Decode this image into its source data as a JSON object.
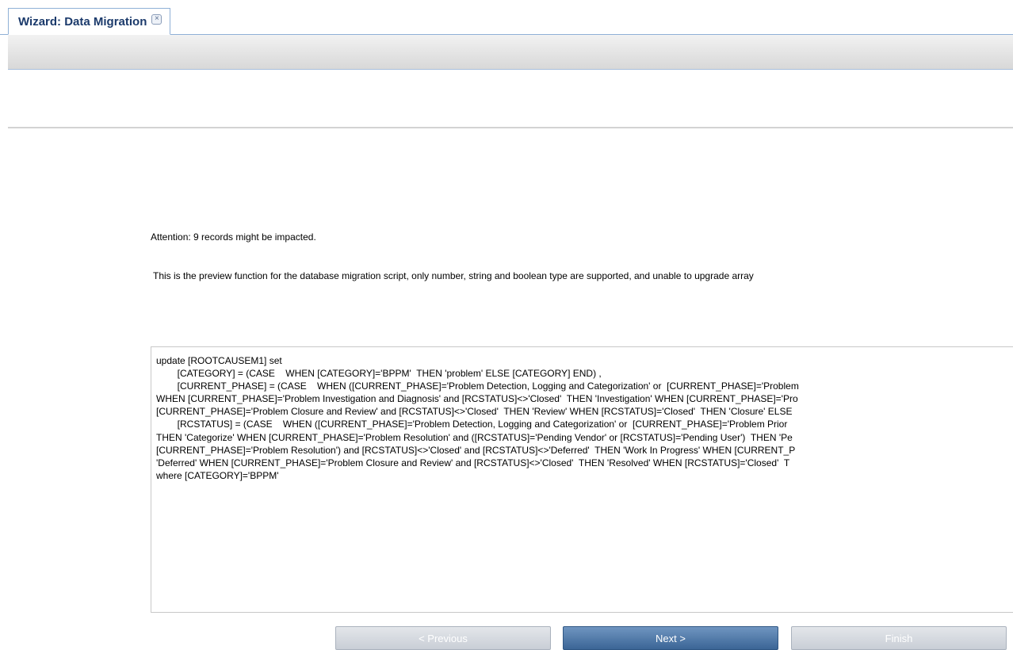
{
  "tab": {
    "title": "Wizard: Data Migration",
    "close_glyph": "×",
    "close_icon": "close-icon"
  },
  "page": {
    "attention": "Attention: 9 records might be impacted.",
    "description": "This is the preview function for the database migration script, only number, string and boolean type are supported, and unable to upgrade array"
  },
  "script": {
    "lines": [
      "update [ROOTCAUSEM1] set",
      "        [CATEGORY] = (CASE    WHEN [CATEGORY]='BPPM'  THEN 'problem' ELSE [CATEGORY] END) ,",
      "        [CURRENT_PHASE] = (CASE    WHEN ([CURRENT_PHASE]='Problem Detection, Logging and Categorization' or  [CURRENT_PHASE]='Problem",
      "WHEN [CURRENT_PHASE]='Problem Investigation and Diagnosis' and [RCSTATUS]<>'Closed'  THEN 'Investigation' WHEN [CURRENT_PHASE]='Pro",
      "[CURRENT_PHASE]='Problem Closure and Review' and [RCSTATUS]<>'Closed'  THEN 'Review' WHEN [RCSTATUS]='Closed'  THEN 'Closure' ELSE",
      "        [RCSTATUS] = (CASE    WHEN ([CURRENT_PHASE]='Problem Detection, Logging and Categorization' or  [CURRENT_PHASE]='Problem Prior",
      "THEN 'Categorize' WHEN [CURRENT_PHASE]='Problem Resolution' and ([RCSTATUS]='Pending Vendor' or [RCSTATUS]='Pending User')  THEN 'Pe",
      "[CURRENT_PHASE]='Problem Resolution') and [RCSTATUS]<>'Closed' and [RCSTATUS]<>'Deferred'  THEN 'Work In Progress' WHEN [CURRENT_P",
      "'Deferred' WHEN [CURRENT_PHASE]='Problem Closure and Review' and [RCSTATUS]<>'Closed'  THEN 'Resolved' WHEN [RCSTATUS]='Closed'  T",
      "where [CATEGORY]='BPPM'"
    ]
  },
  "buttons": {
    "previous": "< Previous",
    "next": "Next >",
    "finish": "Finish"
  },
  "colors": {
    "primary_button": "#3b6596",
    "disabled_button": "#c9ced6",
    "tab_text": "#1b3a6b",
    "tab_border": "#8fb0d6"
  }
}
